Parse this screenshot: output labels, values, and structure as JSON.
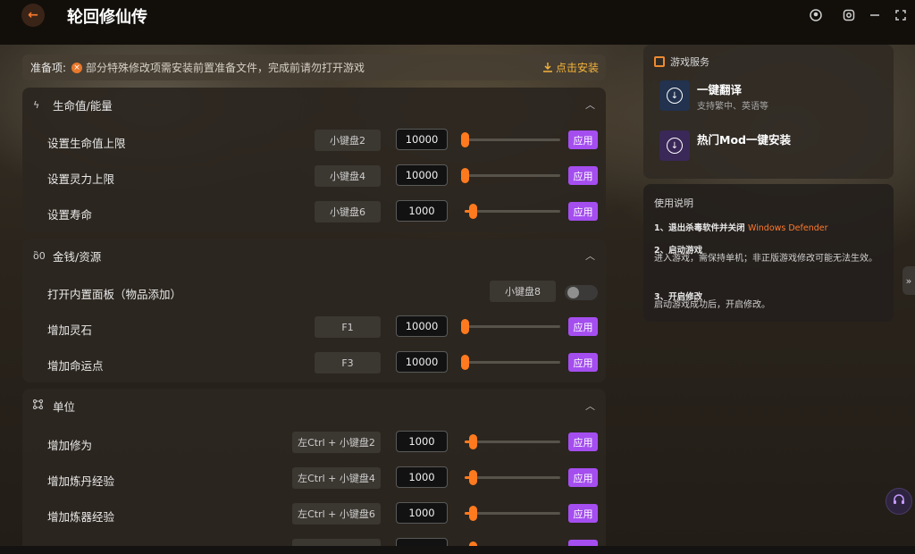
{
  "app": {
    "title": "轮回修仙传",
    "back_icon": "back-arrow-icon"
  },
  "window_controls": [
    "profile-icon",
    "settings-icon",
    "minimize-icon",
    "close-icon"
  ],
  "prep": {
    "label": "准备项:",
    "warning": "部分特殊修改项需安装前置准备文件，完成前请勿打开游戏",
    "install": "点击安装"
  },
  "sections": [
    {
      "title": "生命值/能量",
      "icon": "lightning-icon",
      "rows": [
        {
          "label": "设置生命值上限",
          "key": "小键盘2",
          "value": "10000",
          "slider": 0.0,
          "apply": "应用"
        },
        {
          "label": "设置灵力上限",
          "key": "小键盘4",
          "value": "10000",
          "slider": 0.0,
          "apply": "应用"
        },
        {
          "label": "设置寿命",
          "key": "小键盘6",
          "value": "1000",
          "slider": 0.09,
          "apply": "应用"
        }
      ]
    },
    {
      "title": "金钱/资源",
      "icon": "coin-bag-icon",
      "rows": [
        {
          "label": "打开内置面板（物品添加）",
          "key": "小键盘8",
          "toggle": false
        },
        {
          "label": "增加灵石",
          "key": "F1",
          "value": "10000",
          "slider": 0.0,
          "apply": "应用"
        },
        {
          "label": "增加命运点",
          "key": "F3",
          "value": "10000",
          "slider": 0.0,
          "apply": "应用"
        }
      ]
    },
    {
      "title": "单位",
      "icon": "nodes-icon",
      "rows": [
        {
          "label": "增加修为",
          "key": "左Ctrl + 小键盘2",
          "value": "1000",
          "slider": 0.09,
          "apply": "应用"
        },
        {
          "label": "增加炼丹经验",
          "key": "左Ctrl + 小键盘4",
          "value": "1000",
          "slider": 0.09,
          "apply": "应用"
        },
        {
          "label": "增加炼器经验",
          "key": "左Ctrl + 小键盘6",
          "value": "1000",
          "slider": 0.09,
          "apply": "应用"
        }
      ]
    }
  ],
  "services": {
    "title": "游戏服务",
    "items": [
      {
        "name": "一键翻译",
        "sub": "支持繁中、英语等",
        "color": "#2a3a5a"
      },
      {
        "name": "热门Mod一键安装",
        "sub": "",
        "color": "#3a2858"
      }
    ]
  },
  "usage": {
    "title": "使用说明",
    "step1": "1、退出杀毒软件并关闭",
    "step1_hl": "Windows Defender",
    "step2": "2、启动游戏",
    "step2_desc": "进入游戏，需保持单机；非正版游戏修改可能无法生效。",
    "step3": "3、开启修改",
    "step3_desc": "启动游戏成功后，开启修改。"
  },
  "colors": {
    "accent": "#a54ef0",
    "slider": "#ff7a1e",
    "warning": "#f5b43a"
  }
}
